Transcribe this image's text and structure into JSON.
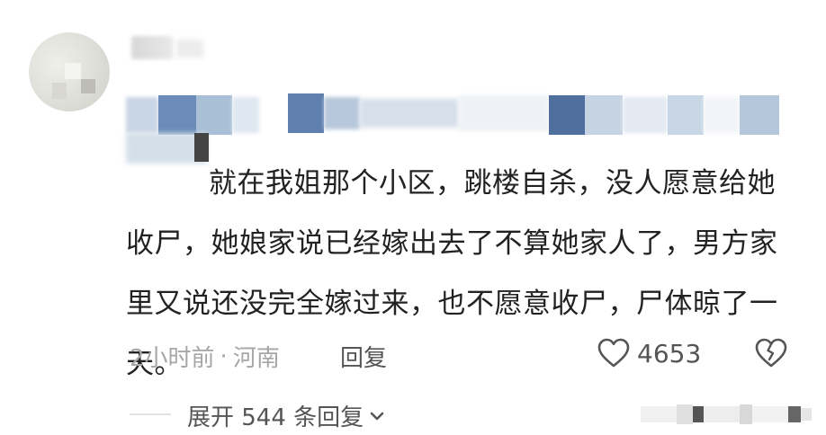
{
  "comment": {
    "text": "就在我姐那个小区，跳楼自杀，没人愿意给她收尸，她娘家说已经嫁出去了不算她家人了，男方家里又说还没完全嫁过来，也不愿意收尸，尸体晾了一天。"
  },
  "meta": {
    "time": "2小时前",
    "separator": "·",
    "location": "河南",
    "reply_label": "回复"
  },
  "likes": {
    "count": "4653",
    "like_icon": "heart-outline-icon",
    "dislike_icon": "broken-heart-icon"
  },
  "replies": {
    "expand_label": "展开 544 条回复",
    "expand_icon": "chevron-down-icon"
  },
  "colors": {
    "text": "#222222",
    "meta": "#a6a6a6",
    "action": "#555555"
  }
}
